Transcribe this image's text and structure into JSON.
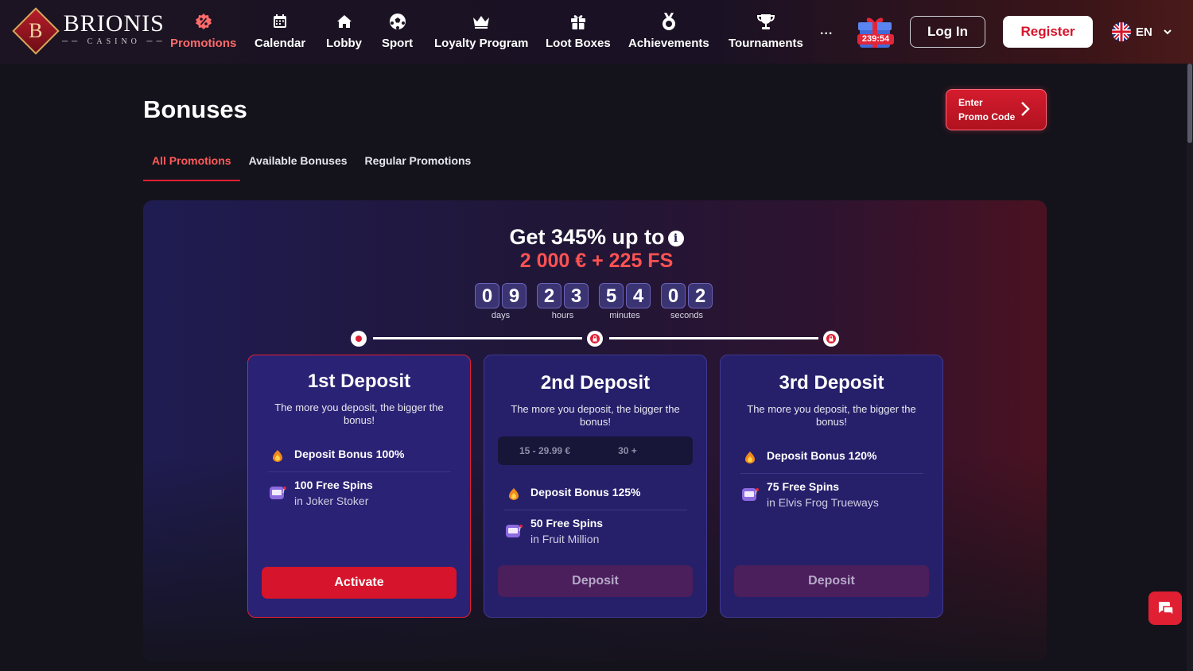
{
  "brand": {
    "name": "BRIONIS",
    "sub": "CASINO",
    "letter": "B"
  },
  "nav": [
    {
      "label": "Promotions",
      "icon": "percent-badge-icon",
      "active": true
    },
    {
      "label": "Calendar",
      "icon": "calendar-icon"
    },
    {
      "label": "Lobby",
      "icon": "home-icon"
    },
    {
      "label": "Sport",
      "icon": "soccer-ball-icon"
    },
    {
      "label": "Loyalty Program",
      "icon": "crown-icon"
    },
    {
      "label": "Loot Boxes",
      "icon": "gift-icon"
    },
    {
      "label": "Achievements",
      "icon": "medal-icon"
    },
    {
      "label": "Tournaments",
      "icon": "trophy-icon"
    }
  ],
  "header": {
    "more": "...",
    "gift_timer": "239:54",
    "login_label": "Log In",
    "register_label": "Register",
    "language": "EN"
  },
  "page": {
    "title": "Bonuses",
    "promo_button": {
      "line1": "Enter",
      "line2": "Promo Code"
    }
  },
  "tabs": [
    {
      "label": "All Promotions",
      "active": true
    },
    {
      "label": "Available Bonuses"
    },
    {
      "label": "Regular Promotions"
    }
  ],
  "banner": {
    "headline": "Get 345% up to",
    "subline": "2 000 € + 225 FS",
    "countdown": [
      {
        "digits": [
          "0",
          "9"
        ],
        "label": "days"
      },
      {
        "digits": [
          "2",
          "3"
        ],
        "label": "hours"
      },
      {
        "digits": [
          "5",
          "4"
        ],
        "label": "minutes"
      },
      {
        "digits": [
          "0",
          "2"
        ],
        "label": "seconds"
      }
    ]
  },
  "cards": [
    {
      "title": "1st Deposit",
      "subtitle": "The more you deposit, the bigger the bonus!",
      "perks": [
        {
          "title": "Deposit Bonus 100%",
          "icon": "fire-bag-icon"
        },
        {
          "title": "100 Free Spins",
          "sub": "in Joker Stoker",
          "icon": "slot-machine-icon"
        }
      ],
      "button": "Activate"
    },
    {
      "title": "2nd Deposit",
      "subtitle": "The more you deposit, the bigger the bonus!",
      "range": [
        "15 - 29.99 €",
        "30 +"
      ],
      "perks": [
        {
          "title": "Deposit Bonus 125%",
          "icon": "fire-bag-icon"
        },
        {
          "title": "50 Free Spins",
          "sub": "in Fruit Million",
          "icon": "slot-machine-icon"
        }
      ],
      "button": "Deposit"
    },
    {
      "title": "3rd Deposit",
      "subtitle": "The more you deposit, the bigger the bonus!",
      "perks": [
        {
          "title": "Deposit Bonus 120%",
          "icon": "fire-bag-icon"
        },
        {
          "title": "75 Free Spins",
          "sub": "in Elvis Frog Trueways",
          "icon": "slot-machine-icon"
        }
      ],
      "button": "Deposit"
    }
  ],
  "colors": {
    "accent": "#e01f33",
    "card": "#26206b",
    "background": "#14131b"
  }
}
